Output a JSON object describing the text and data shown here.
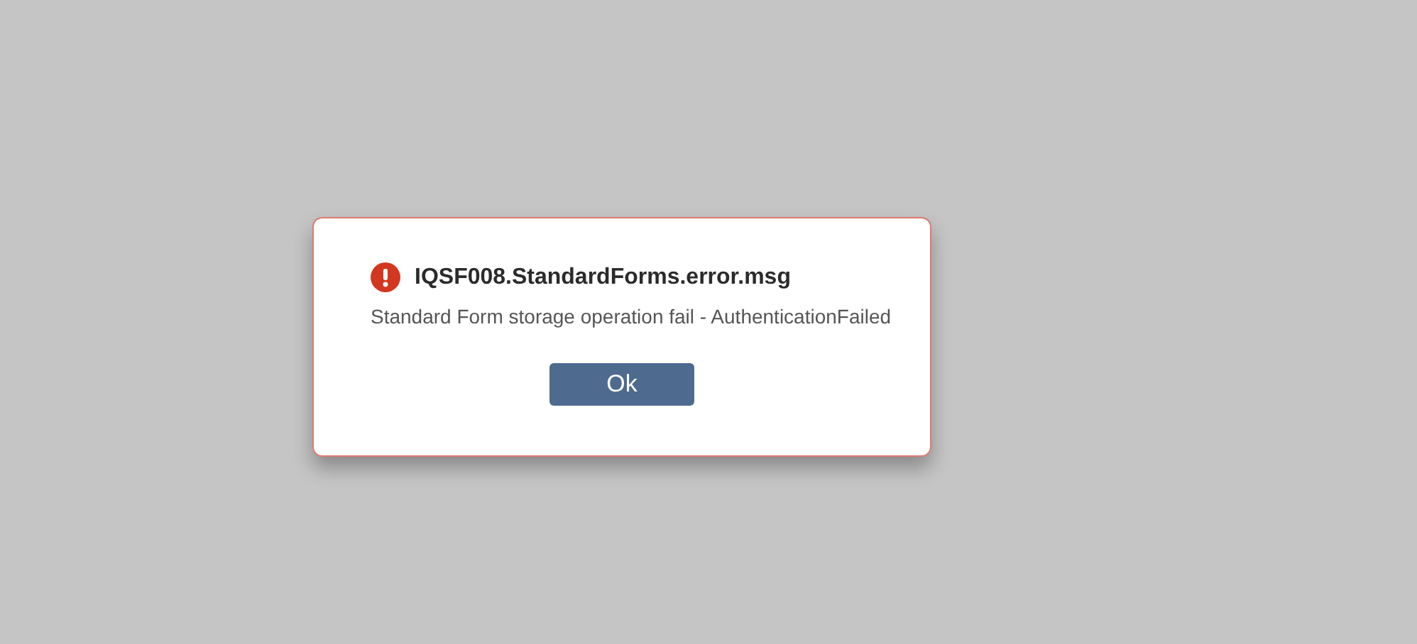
{
  "dialog": {
    "kind": "error",
    "title": "IQSF008.StandardForms.error.msg",
    "message": "Standard Form storage operation fail - AuthenticationFailed",
    "buttons": [
      "Ok"
    ]
  }
}
